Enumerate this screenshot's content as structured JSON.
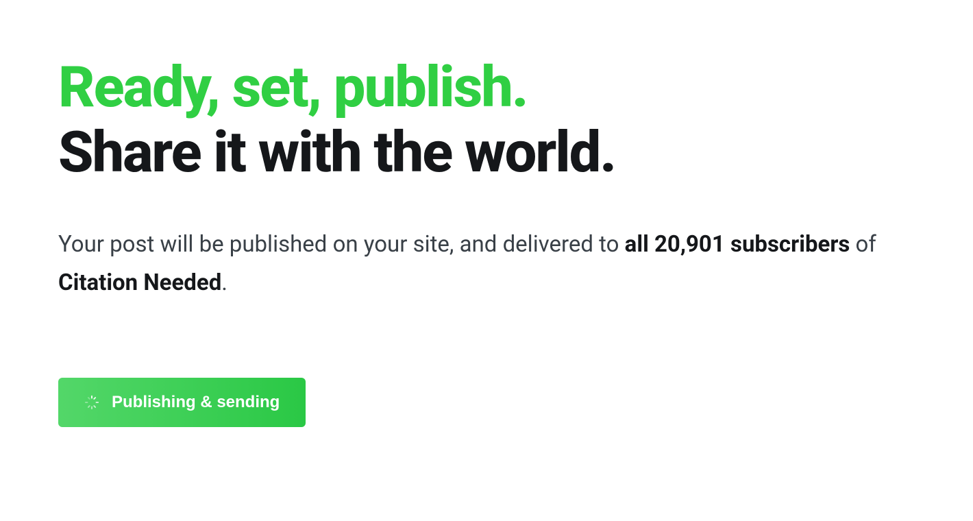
{
  "heading": {
    "line1": "Ready, set, publish.",
    "line2": "Share it with the world."
  },
  "subtext": {
    "prefix": "Your post will be published on your site, and delivered to ",
    "subscribers_bold": "all 20,901 subscribers",
    "middle": " of ",
    "publication_bold": "Citation Needed",
    "suffix": "."
  },
  "button": {
    "label": "Publishing & sending"
  }
}
